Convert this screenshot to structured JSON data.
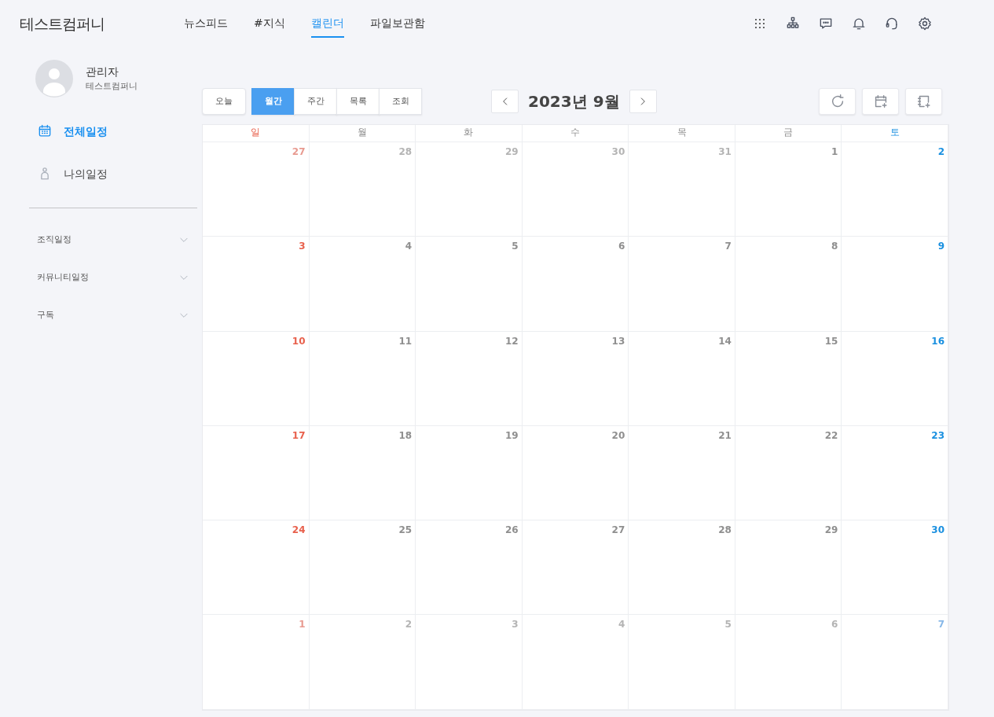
{
  "header": {
    "logo": "테스트컴퍼니",
    "nav": [
      {
        "label": "뉴스피드",
        "selected": false
      },
      {
        "label": "#지식",
        "selected": false
      },
      {
        "label": "캘린더",
        "selected": true
      },
      {
        "label": "파일보관함",
        "selected": false
      }
    ]
  },
  "profile": {
    "name": "관리자",
    "company": "테스트컴퍼니"
  },
  "sidebar": {
    "items": [
      {
        "label": "전체일정",
        "selected": true
      },
      {
        "label": "나의일정",
        "selected": false
      }
    ],
    "groups": [
      {
        "label": "조직일정",
        "expanded": false
      },
      {
        "label": "커뮤니티일정",
        "expanded": false
      },
      {
        "label": "구독",
        "expanded": false
      }
    ]
  },
  "toolbar": {
    "today": "오늘",
    "views": [
      {
        "label": "월간",
        "selected": true
      },
      {
        "label": "주간",
        "selected": false
      },
      {
        "label": "목록",
        "selected": false
      },
      {
        "label": "조회",
        "selected": false
      }
    ],
    "title": "2023년 9월"
  },
  "calendar": {
    "weekdays": [
      "일",
      "월",
      "화",
      "수",
      "목",
      "금",
      "토"
    ],
    "weeks": [
      [
        {
          "day": "27",
          "other_month": true
        },
        {
          "day": "28",
          "other_month": true
        },
        {
          "day": "29",
          "other_month": true
        },
        {
          "day": "30",
          "other_month": true
        },
        {
          "day": "31",
          "other_month": true
        },
        {
          "day": "1",
          "other_month": false
        },
        {
          "day": "2",
          "other_month": false
        }
      ],
      [
        {
          "day": "3",
          "other_month": false
        },
        {
          "day": "4",
          "other_month": false
        },
        {
          "day": "5",
          "other_month": false
        },
        {
          "day": "6",
          "other_month": false
        },
        {
          "day": "7",
          "other_month": false
        },
        {
          "day": "8",
          "other_month": false
        },
        {
          "day": "9",
          "other_month": false
        }
      ],
      [
        {
          "day": "10",
          "other_month": false
        },
        {
          "day": "11",
          "other_month": false
        },
        {
          "day": "12",
          "other_month": false
        },
        {
          "day": "13",
          "other_month": false
        },
        {
          "day": "14",
          "other_month": false
        },
        {
          "day": "15",
          "other_month": false
        },
        {
          "day": "16",
          "other_month": false
        }
      ],
      [
        {
          "day": "17",
          "other_month": false
        },
        {
          "day": "18",
          "other_month": false
        },
        {
          "day": "19",
          "other_month": false
        },
        {
          "day": "20",
          "other_month": false
        },
        {
          "day": "21",
          "other_month": false
        },
        {
          "day": "22",
          "other_month": false
        },
        {
          "day": "23",
          "other_month": false
        }
      ],
      [
        {
          "day": "24",
          "other_month": false
        },
        {
          "day": "25",
          "other_month": false
        },
        {
          "day": "26",
          "other_month": false
        },
        {
          "day": "27",
          "other_month": false
        },
        {
          "day": "28",
          "other_month": false
        },
        {
          "day": "29",
          "other_month": false
        },
        {
          "day": "30",
          "other_month": false
        }
      ],
      [
        {
          "day": "1",
          "other_month": true
        },
        {
          "day": "2",
          "other_month": true
        },
        {
          "day": "3",
          "other_month": true
        },
        {
          "day": "4",
          "other_month": true
        },
        {
          "day": "5",
          "other_month": true
        },
        {
          "day": "6",
          "other_month": true
        },
        {
          "day": "7",
          "other_month": true
        }
      ]
    ]
  }
}
